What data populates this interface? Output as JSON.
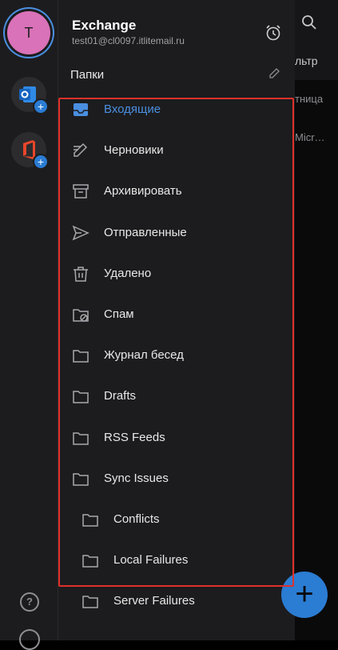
{
  "account": {
    "initial": "T",
    "name": "Exchange",
    "email": "test01@cl0097.itlitemail.ru"
  },
  "folders_header": "Папки",
  "folders": [
    {
      "label": "Входящие",
      "icon": "inbox-icon",
      "active": true
    },
    {
      "label": "Черновики",
      "icon": "drafts-pencil-icon"
    },
    {
      "label": "Архивировать",
      "icon": "archive-icon"
    },
    {
      "label": "Отправленные",
      "icon": "send-icon"
    },
    {
      "label": "Удалено",
      "icon": "trash-icon"
    },
    {
      "label": "Спам",
      "icon": "spam-folder-icon"
    },
    {
      "label": "Журнал бесед",
      "icon": "folder-icon"
    },
    {
      "label": "Drafts",
      "icon": "folder-icon"
    },
    {
      "label": "RSS Feeds",
      "icon": "folder-icon"
    },
    {
      "label": "Sync Issues",
      "icon": "folder-icon"
    },
    {
      "label": "Conflicts",
      "icon": "folder-icon",
      "nested": true
    },
    {
      "label": "Local Failures",
      "icon": "folder-icon",
      "nested": true
    },
    {
      "label": "Server Failures",
      "icon": "folder-icon",
      "nested": true
    }
  ],
  "peek": {
    "filter": "льтр",
    "row1": "тница",
    "row2": "Micr…"
  },
  "colors": {
    "accent": "#4a8fe0",
    "highlight": "#e0302a",
    "avatar": "#d972b8"
  }
}
